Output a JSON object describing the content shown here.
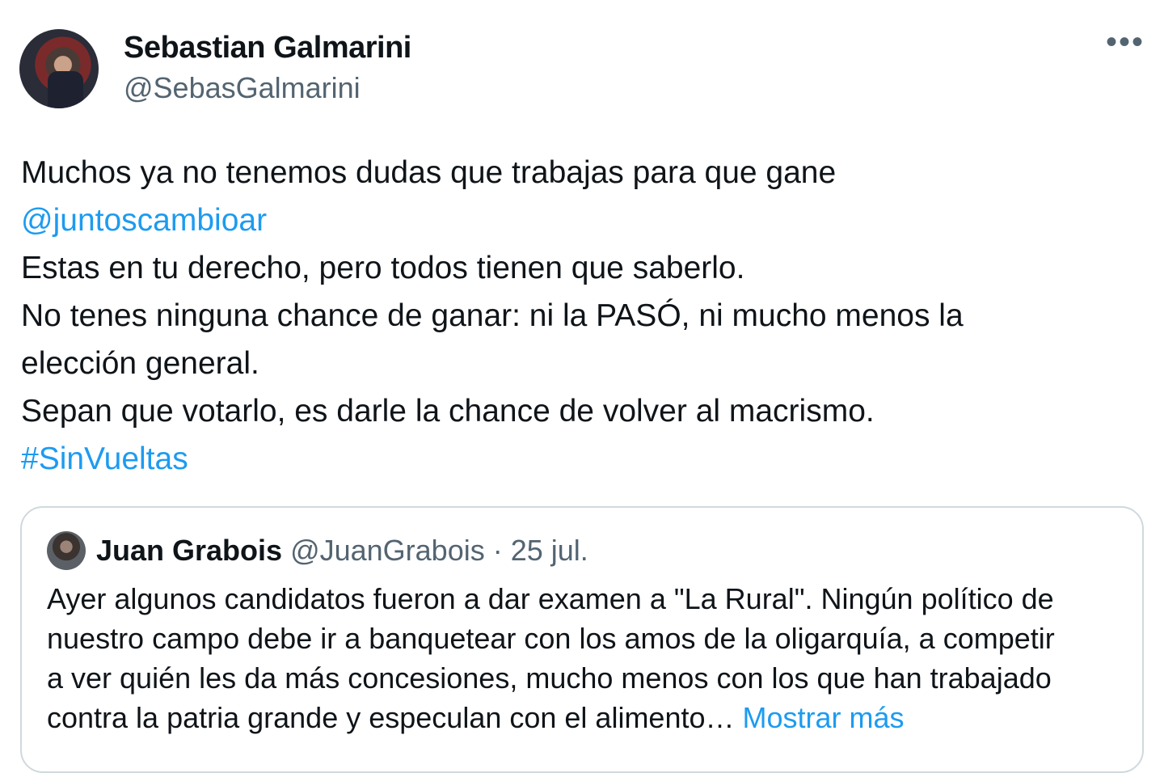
{
  "author": {
    "display_name": "Sebastian Galmarini",
    "handle": "@SebasGalmarini"
  },
  "more_icon": "more-options-icon",
  "more_label": "•••",
  "tweet": {
    "lines": [
      "Muchos ya no tenemos dudas que trabajas para que gane",
      "@juntoscambioar",
      "Estas en tu derecho, pero todos tienen que saberlo.",
      "No tenes ninguna chance de ganar: ni la PASÓ, ni mucho menos la",
      "elección general.",
      "Sepan que votarlo, es darle la chance de volver al macrismo.",
      "#SinVueltas"
    ]
  },
  "quote": {
    "display_name": "Juan Grabois",
    "meta": " @JuanGrabois · 25 jul.",
    "lines": [
      "Ayer algunos candidatos fueron a dar examen a \"La Rural\". Ningún político de",
      "nuestro campo debe ir a banquetear con los amos de la oligarquía, a competir",
      "a ver quién les da más concesiones, mucho menos con los que han trabajado",
      "contra la patria grande y especulan con el alimento… "
    ],
    "show_more": "Mostrar más"
  },
  "colors": {
    "link": "#1d9bf0",
    "text": "#0f1419",
    "secondary": "#536471",
    "border": "#cfd9de"
  }
}
